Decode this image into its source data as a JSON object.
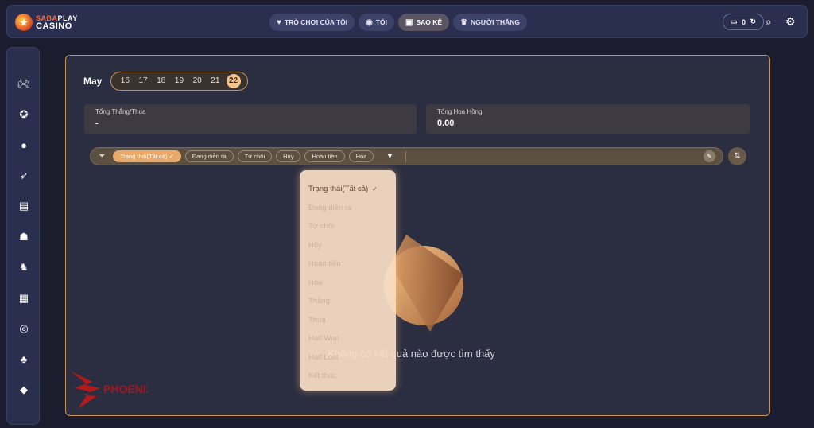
{
  "brand": {
    "top_left": "SABA",
    "top_right": "PLAY",
    "bottom": "CASINO"
  },
  "nav": {
    "tabs": [
      {
        "label": "TRÒ CHƠI CỦA TÔI",
        "icon": "heart-plus-icon"
      },
      {
        "label": "TÔI",
        "icon": "user-badge-icon"
      },
      {
        "label": "SAO KÊ",
        "icon": "ticket-icon"
      },
      {
        "label": "NGƯỜI THẮNG",
        "icon": "crown-icon"
      }
    ],
    "wallet_balance": "0"
  },
  "sidebar": {
    "items": [
      "gamepad-icon",
      "medal-icon",
      "chat-icon",
      "rocket-icon",
      "cards-icon",
      "dealer-icon",
      "horse-icon",
      "slot-icon",
      "ball-icon",
      "joystick-icon",
      "fish-icon"
    ]
  },
  "date_picker": {
    "month": "May",
    "days": [
      "16",
      "17",
      "18",
      "19",
      "20",
      "21",
      "22"
    ],
    "selected": "22"
  },
  "stats": [
    {
      "label": "Tổng Thắng/Thua",
      "value": "-"
    },
    {
      "label": "Tổng Hoa Hồng",
      "value": "0.00"
    }
  ],
  "filters": {
    "chips": [
      "Trạng thái(Tất cả)",
      "Đang diễn ra",
      "Từ chối",
      "Hủy",
      "Hoàn tiền",
      "Hòa"
    ],
    "active_index": 0
  },
  "dropdown": {
    "items": [
      "Trạng thái(Tất cả)",
      "Đang diễn ra",
      "Từ chối",
      "Hủy",
      "Hoàn tiền",
      "Hòa",
      "Thắng",
      "Thua",
      "Half Won",
      "Half Lost",
      "Kết thúc"
    ],
    "selected_index": 0
  },
  "empty_state": {
    "message": "Không có kết quả nào được tìm thấy"
  },
  "watermark": {
    "text": "PHOENIX"
  },
  "colors": {
    "accent": "#c9955a",
    "chip_active": "#e8a96b",
    "panel": "#2b2d40",
    "bar": "#2a2e4f"
  }
}
